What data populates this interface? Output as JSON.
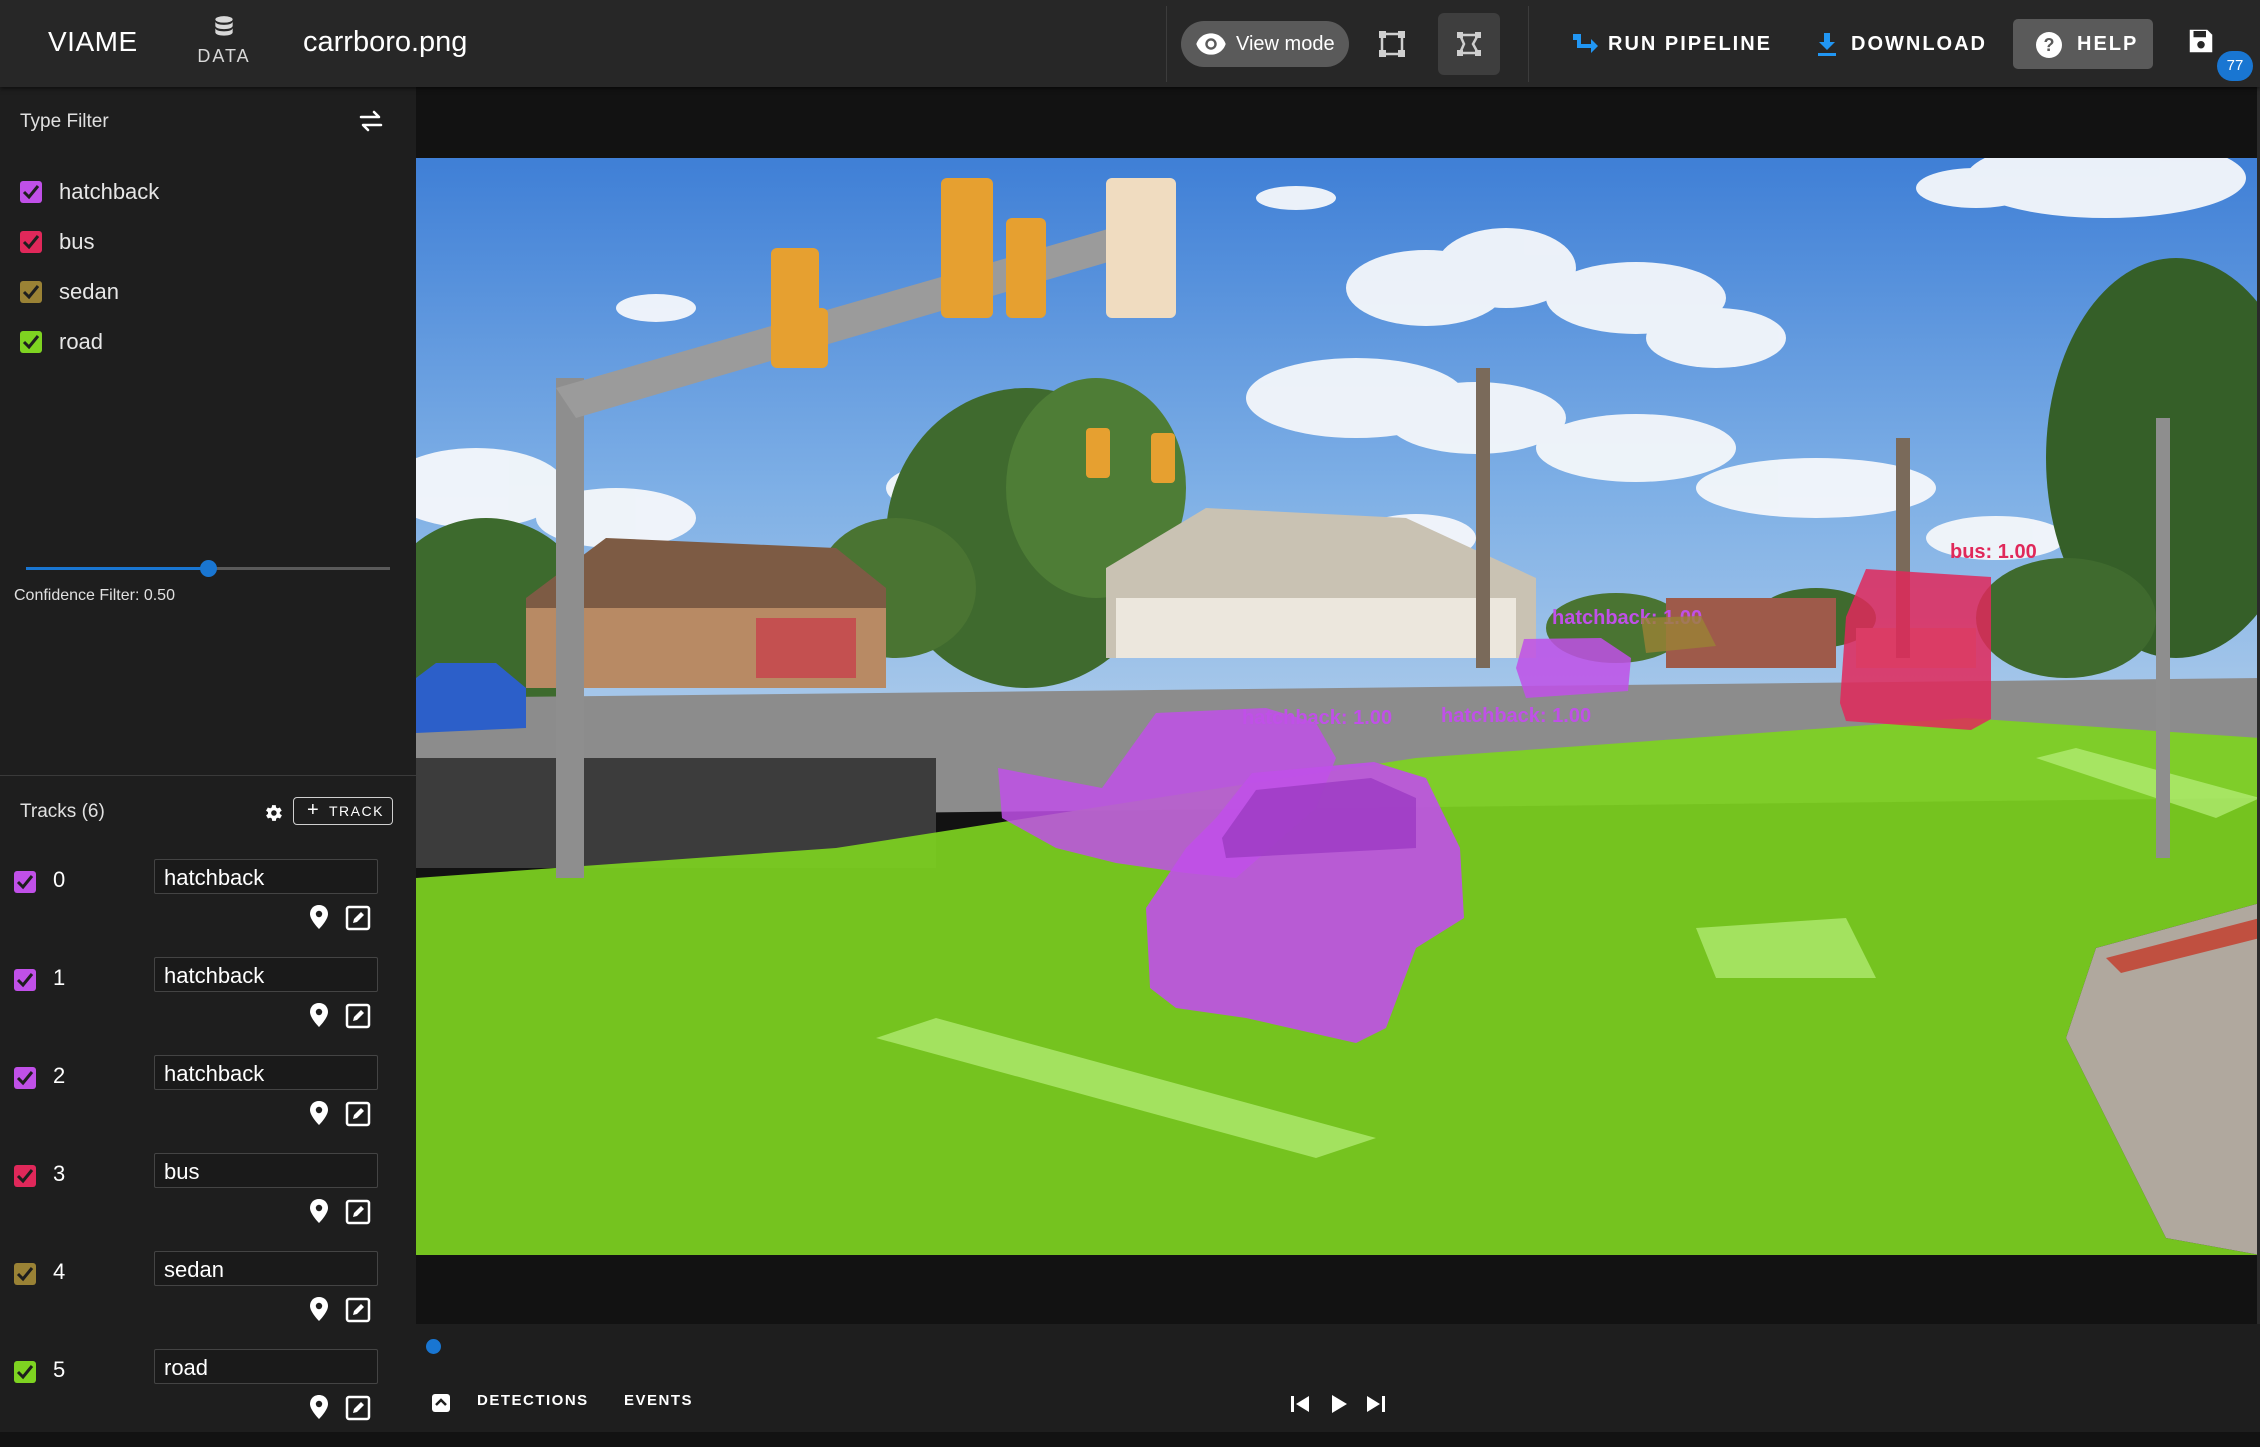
{
  "header": {
    "app_title": "VIAME",
    "data_label": "DATA",
    "filename": "carrboro.png",
    "view_mode_label": "View mode",
    "run_pipeline_label": "RUN PIPELINE",
    "download_label": "DOWNLOAD",
    "help_label": "HELP",
    "save_badge": "77"
  },
  "type_filter": {
    "title": "Type Filter",
    "types": [
      {
        "label": "hatchback",
        "color": "#c050e8",
        "checked": true
      },
      {
        "label": "bus",
        "color": "#e0285a",
        "checked": true
      },
      {
        "label": "sedan",
        "color": "#9a8235",
        "checked": true
      },
      {
        "label": "road",
        "color": "#7ed321",
        "checked": true
      }
    ]
  },
  "confidence": {
    "label": "Confidence Filter: 0.50",
    "value": 0.5
  },
  "tracks": {
    "title": "Tracks (6)",
    "add_label": "TRACK",
    "items": [
      {
        "id": "0",
        "type": "hatchback",
        "color": "#c050e8"
      },
      {
        "id": "1",
        "type": "hatchback",
        "color": "#c050e8"
      },
      {
        "id": "2",
        "type": "hatchback",
        "color": "#c050e8"
      },
      {
        "id": "3",
        "type": "bus",
        "color": "#e0285a"
      },
      {
        "id": "4",
        "type": "sedan",
        "color": "#9a8235"
      },
      {
        "id": "5",
        "type": "road",
        "color": "#7ed321"
      }
    ]
  },
  "annotations": {
    "label_0": "hatchback: 1.00",
    "label_1": "hatchback: 1.00",
    "label_2": "hatchback: 1.00",
    "label_3": "bus: 1.00"
  },
  "bottom": {
    "tab_detections": "DETECTIONS",
    "tab_events": "EVENTS"
  },
  "colors": {
    "accent": "#1976d2",
    "hatchback": "#c050e8",
    "bus": "#e0285a",
    "sedan": "#9a8235",
    "road": "#7ed321"
  },
  "icons": [
    "database-icon",
    "eye-icon",
    "rectangle-tool-icon",
    "polygon-tool-icon",
    "pipeline-icon",
    "download-icon",
    "help-icon",
    "save-icon",
    "swap-icon",
    "gear-icon",
    "location-icon",
    "edit-icon",
    "skip-previous-icon",
    "play-icon",
    "skip-next-icon",
    "chevron-up-icon"
  ]
}
